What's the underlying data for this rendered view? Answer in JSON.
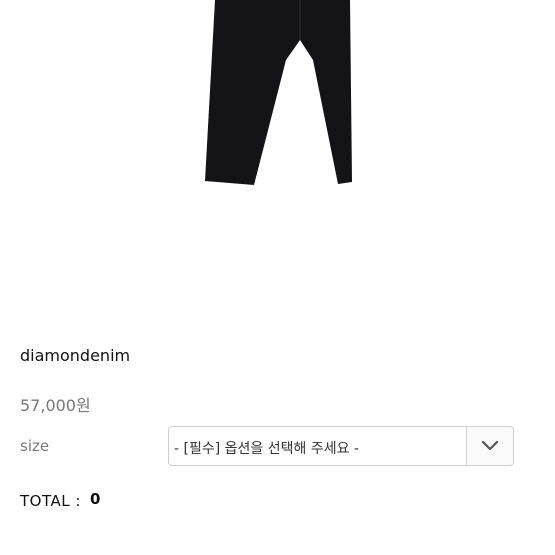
{
  "product": {
    "brand": "diamondenim",
    "price": "57,000원"
  },
  "options": {
    "size_label": "size",
    "size_select_value": "- [필수] 옵션을 선택해 주세요 -",
    "dropdown_icon": "chevron-down-icon"
  },
  "summary": {
    "total_label": "TOTAL :",
    "total_value": "0"
  },
  "image": {
    "subject": "black-slim-pants",
    "pants_color": "#141416"
  }
}
